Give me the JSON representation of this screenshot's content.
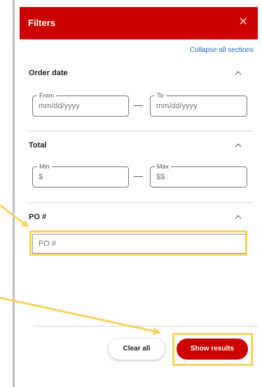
{
  "panel": {
    "title": "Filters",
    "collapse_all_label": "Collapse all sections"
  },
  "sections": {
    "order_date": {
      "title": "Order date",
      "from_label": "From",
      "from_placeholder": "mm/dd/yyyy",
      "to_label": "To",
      "to_placeholder": "mm/dd/yyyy",
      "separator": "—"
    },
    "total": {
      "title": "Total",
      "min_label": "Min",
      "min_placeholder": "$",
      "max_label": "Max",
      "max_placeholder": "$$",
      "separator": "—"
    },
    "po": {
      "title": "PO #",
      "placeholder": "PO #"
    }
  },
  "footer": {
    "clear_label": "Clear all",
    "show_label": "Show results"
  },
  "icons": {
    "close": "close-icon",
    "chevron": "chevron-up-icon"
  },
  "colors": {
    "brand_red": "#cc0000",
    "link_blue": "#1f69c2",
    "highlight_yellow": "#f5d35c"
  }
}
